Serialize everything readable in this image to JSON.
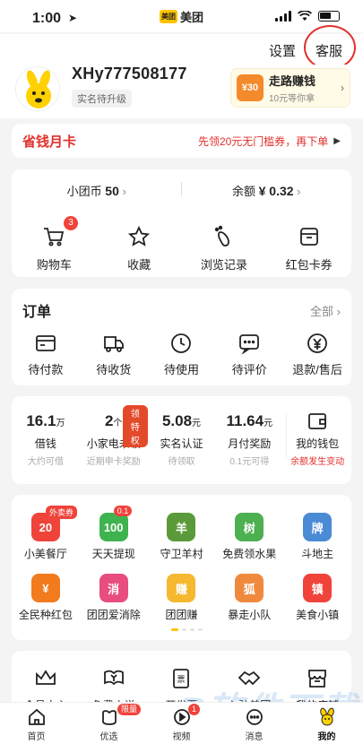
{
  "status": {
    "time": "1:00",
    "app_name": "美团",
    "app_logo_text": "美团"
  },
  "top": {
    "settings": "设置",
    "service": "客服"
  },
  "profile": {
    "username": "XHy777508177",
    "verify_badge": "实名待升级",
    "walk_title": "走路赚钱",
    "walk_desc": "10元等你拿",
    "walk_icon_text": "¥30"
  },
  "save_card": {
    "title": "省钱月卡",
    "desc": "先领20元无门槛券，再下单"
  },
  "wallet": {
    "coin_label": "小团币",
    "coin_value": "50",
    "balance_label": "余额",
    "balance_value": "¥ 0.32",
    "items": [
      {
        "label": "购物车",
        "icon": "cart-icon",
        "badge": "3"
      },
      {
        "label": "收藏",
        "icon": "star-icon"
      },
      {
        "label": "浏览记录",
        "icon": "footprint-icon"
      },
      {
        "label": "红包卡券",
        "icon": "coupon-icon"
      }
    ]
  },
  "orders": {
    "title": "订单",
    "all": "全部",
    "items": [
      {
        "label": "待付款",
        "icon": "card-icon"
      },
      {
        "label": "待收货",
        "icon": "truck-icon"
      },
      {
        "label": "待使用",
        "icon": "clock-icon"
      },
      {
        "label": "待评价",
        "icon": "comment-icon"
      },
      {
        "label": "退款/售后",
        "icon": "refund-icon"
      }
    ]
  },
  "finance": {
    "items": [
      {
        "num": "16.1",
        "unit": "万",
        "label": "借钱",
        "sub": "大约可借"
      },
      {
        "num": "2",
        "unit": "个",
        "label": "小家电未领",
        "sub": "近期申卡奖励",
        "tag": "领特权"
      },
      {
        "num": "5.08",
        "unit": "元",
        "label": "实名认证",
        "sub": "待领取"
      },
      {
        "num": "11.64",
        "unit": "元",
        "label": "月付奖励",
        "sub": "0.1元可得"
      },
      {
        "label": "我的钱包",
        "sub": "余额发生变动",
        "icon": "wallet-icon"
      }
    ]
  },
  "services": {
    "row1": [
      {
        "label": "小美餐厅",
        "badge": "外卖券",
        "icon_text": "20",
        "color": "#f0433a"
      },
      {
        "label": "天天提现",
        "badge": "0.1",
        "icon_text": "100",
        "color": "#3fb34f"
      },
      {
        "label": "守卫羊村",
        "icon_text": "羊",
        "color": "#5a9a3a"
      },
      {
        "label": "免费领水果",
        "icon_text": "树",
        "color": "#4caf50"
      },
      {
        "label": "斗地主",
        "icon_text": "牌",
        "color": "#4a8bd6"
      }
    ],
    "row2": [
      {
        "label": "全民种红包",
        "icon_text": "¥",
        "color": "#f27b1e"
      },
      {
        "label": "团团爱消除",
        "icon_text": "消",
        "color": "#e84d7d"
      },
      {
        "label": "团团赚",
        "icon_text": "赚",
        "color": "#f5b82e"
      },
      {
        "label": "暴走小队",
        "icon_text": "狐",
        "color": "#ef8a3d"
      },
      {
        "label": "美食小镇",
        "icon_text": "镇",
        "color": "#f0433a"
      }
    ]
  },
  "more": {
    "items": [
      {
        "label": "会员中心",
        "icon": "crown-icon"
      },
      {
        "label": "免费小说",
        "icon": "novel-icon"
      },
      {
        "label": "开发票",
        "icon": "invoice-icon"
      },
      {
        "label": "入驻美团",
        "icon": "handshake-icon"
      },
      {
        "label": "我的店铺",
        "icon": "store-icon"
      }
    ]
  },
  "tabs": [
    {
      "label": "首页",
      "icon": "home-icon"
    },
    {
      "label": "优选",
      "icon": "youxuan-icon",
      "badge": "限量"
    },
    {
      "label": "视频",
      "icon": "video-icon",
      "badge": "1"
    },
    {
      "label": "消息",
      "icon": "message-icon"
    },
    {
      "label": "我的",
      "icon": "mine-icon",
      "active": true
    }
  ],
  "watermark": "R软件下载"
}
